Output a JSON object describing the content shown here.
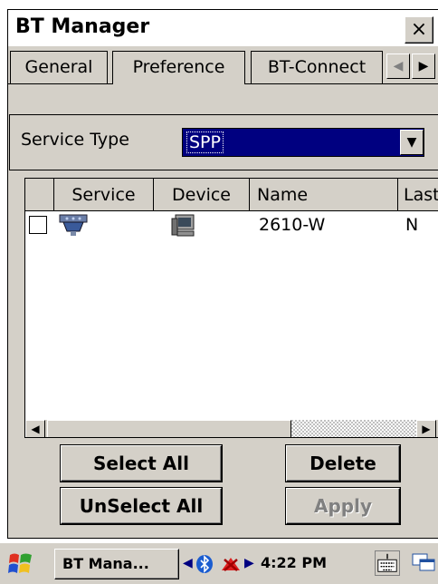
{
  "window": {
    "title": "BT Manager",
    "close_glyph": "×"
  },
  "tabs": [
    {
      "label": "General"
    },
    {
      "label": "Preference",
      "active": true
    },
    {
      "label": "BT-Connect"
    }
  ],
  "tab_scroll": {
    "left": "◀",
    "right": "▶"
  },
  "service_type": {
    "label": "Service Type",
    "value": "SPP",
    "arrow": "▼"
  },
  "list": {
    "columns": [
      "",
      "Service",
      "Device",
      "Name",
      "Last"
    ],
    "rows": [
      {
        "checked": false,
        "service_icon": "serial-port-icon",
        "device_icon": "computer-icon",
        "name": "2610-W",
        "last": "N"
      }
    ]
  },
  "scrollbar": {
    "left": "◀",
    "right": "▶"
  },
  "buttons": {
    "select_all": "Select All",
    "unselect_all": "UnSelect All",
    "delete": "Delete",
    "apply": "Apply"
  },
  "taskbar": {
    "task_label": "BT Mana...",
    "clock": "4:22 PM",
    "tray_left": "◀",
    "tray_right": "▶"
  },
  "colors": {
    "selection": "#000080",
    "face": "#d4d0c8"
  }
}
